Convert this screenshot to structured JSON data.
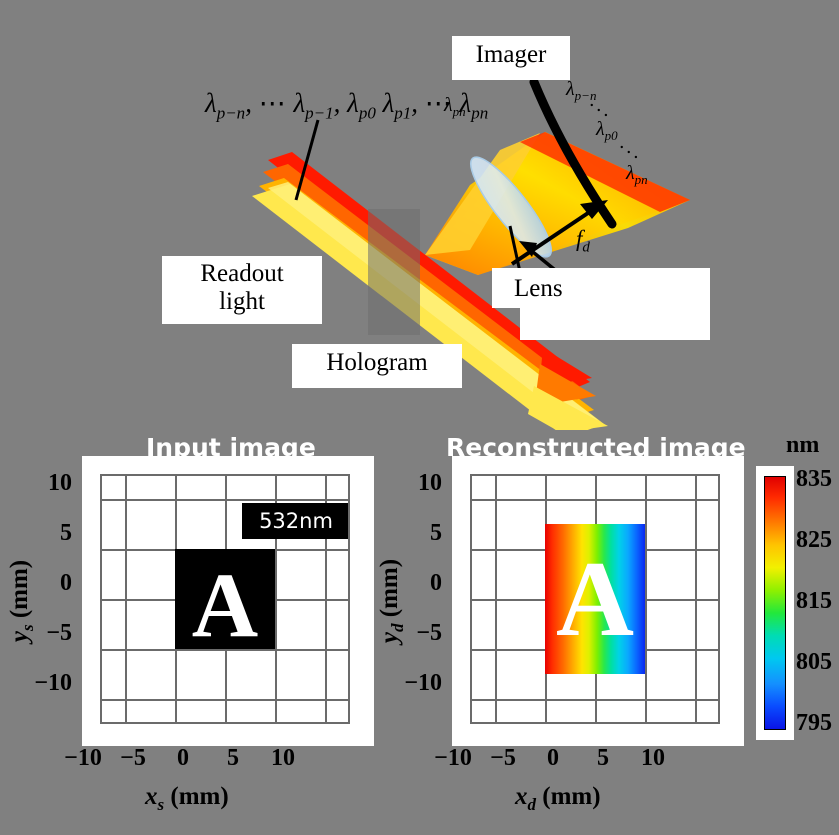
{
  "background_color": "#808080",
  "diagram": {
    "labels": {
      "imager": "Imager",
      "readout_line1": "Readout",
      "readout_line2": "light",
      "hologram": "Hologram",
      "lens": "Lens"
    },
    "lambda_list": {
      "l1": "λ",
      "s1": "p−n",
      "c1": ",",
      "d1": "⋯",
      "l2": "λ",
      "s2": "p−1",
      "c2": ",",
      "l3": "λ",
      "s3": "p0",
      "l4": "λ",
      "s4": "p1",
      "c4": ",",
      "d2": "⋯",
      "l5": "λ",
      "s5": "pn"
    },
    "imager_lambdas": [
      {
        "sym": "λ",
        "sub": "p−n"
      },
      {
        "sym": "λ",
        "sub": "p0"
      },
      {
        "sym": "λ",
        "sub": "pn"
      }
    ],
    "beam_lambda_pn": {
      "sym": "λ",
      "sub": "pn"
    },
    "dots": "···",
    "focal_length": {
      "sym": "f",
      "sub": "d"
    },
    "beam_colors": [
      "#FF1A00",
      "#FF6600",
      "#FFB000",
      "#FFE84D"
    ],
    "hologram_plate_color": "rgba(90,90,90,0.45)",
    "lens_color": "#BBD9F0"
  },
  "plots": {
    "left": {
      "title": "Input image",
      "badge": "532nm",
      "xlabel": {
        "sym": "x",
        "sub": "s",
        "unit": "(mm)"
      },
      "ylabel": {
        "sym": "y",
        "sub": "s",
        "unit": "(mm)"
      },
      "xticks": [
        "−10",
        "−5",
        "0",
        "5",
        "10"
      ],
      "yticks": [
        "10",
        "5",
        "0",
        "−5",
        "−10"
      ],
      "letter": "A",
      "block_color": "#000000",
      "letter_color": "#ffffff"
    },
    "right": {
      "title": "Reconstructed image",
      "xlabel": {
        "sym": "x",
        "sub": "d",
        "unit": "(mm)"
      },
      "ylabel": {
        "sym": "y",
        "sub": "d",
        "unit": "(mm)"
      },
      "xticks": [
        "−10",
        "−5",
        "0",
        "5",
        "10"
      ],
      "yticks": [
        "10",
        "5",
        "0",
        "−5",
        "−10"
      ],
      "letter": "A",
      "letter_color": "#ffffff"
    }
  },
  "colorbar": {
    "unit": "nm",
    "ticks": [
      "835",
      "825",
      "815",
      "805",
      "795"
    ],
    "top_color": "#e00000",
    "bottom_color": "#0a14e6"
  },
  "chart_data": {
    "type": "heatmap",
    "title": "Reconstructed image",
    "xlabel": "x_d (mm)",
    "ylabel": "y_d (mm)",
    "xlim": [
      -12.5,
      12.5
    ],
    "ylim": [
      -12.5,
      12.5
    ],
    "xticks": [
      -10,
      -5,
      0,
      5,
      10
    ],
    "yticks": [
      -10,
      -5,
      0,
      5,
      10
    ],
    "grid": true,
    "colorbar": {
      "label": "nm",
      "ticks": [
        835,
        825,
        815,
        805,
        795
      ],
      "vmin": 795,
      "vmax": 835,
      "colormap": "jet-reversed"
    },
    "image_extent": {
      "x": [
        -5,
        5
      ],
      "y": [
        -7.5,
        7.5
      ]
    },
    "mapping": "wavelength varies linearly with x_d: 835 nm at x=-5 to 795 nm at x=+5",
    "mask_letter": "A",
    "companion": {
      "type": "heatmap",
      "title": "Input image",
      "xlabel": "x_s (mm)",
      "ylabel": "y_s (mm)",
      "xlim": [
        -12.5,
        12.5
      ],
      "ylim": [
        -12.5,
        12.5
      ],
      "xticks": [
        -10,
        -5,
        0,
        5,
        10
      ],
      "yticks": [
        -10,
        -5,
        0,
        5,
        10
      ],
      "image_extent": {
        "x": [
          -5,
          5
        ],
        "y": [
          -5,
          5
        ]
      },
      "wavelength_nm": 532,
      "mask_letter": "A"
    }
  }
}
